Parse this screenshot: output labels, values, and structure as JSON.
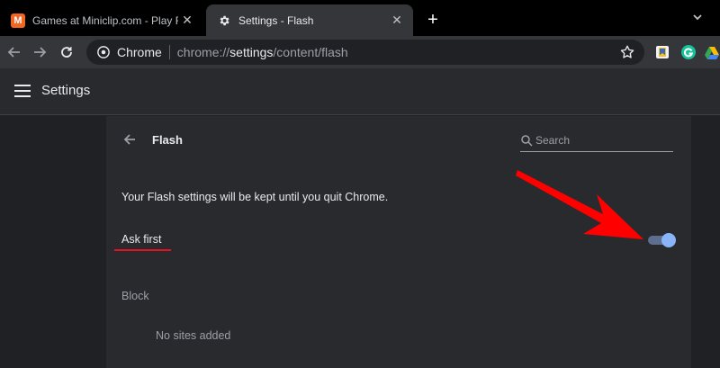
{
  "tabs": [
    {
      "title": "Games at Miniclip.com - Play Free",
      "favicon": "miniclip-icon",
      "favicon_glyph": "M",
      "active": false
    },
    {
      "title": "Settings - Flash",
      "favicon": "gear-icon",
      "active": true
    }
  ],
  "toolbar": {
    "omnibox_label": "Chrome",
    "url_prefix": "chrome://",
    "url_host": "settings",
    "url_path": "/content/flash"
  },
  "settings": {
    "title": "Settings"
  },
  "flash": {
    "title": "Flash",
    "search_placeholder": "Search",
    "info_text": "Your Flash settings will be kept until you quit Chrome.",
    "ask_first_label": "Ask first",
    "ask_first_enabled": true,
    "block_label": "Block",
    "no_sites_text": "No sites added"
  },
  "colors": {
    "accent": "#8ab4f8",
    "annotation": "#e81123",
    "background": "#202124",
    "card": "#292a2d"
  }
}
